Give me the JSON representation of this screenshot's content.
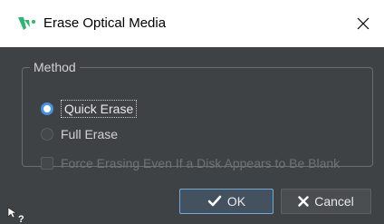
{
  "window": {
    "title": "Erase Optical Media",
    "app_icon": "wavelab-logo-icon",
    "close_icon": "close-icon"
  },
  "method": {
    "legend": "Method",
    "options": [
      {
        "label": "Quick Erase",
        "selected": true,
        "enabled": true
      },
      {
        "label": "Full Erase",
        "selected": false,
        "enabled": true
      }
    ],
    "force_checkbox": {
      "label": "Force Erasing Even If a Disk Appears to Be Blank",
      "checked": false,
      "enabled": false
    }
  },
  "buttons": {
    "ok_label": "OK",
    "ok_icon": "checkmark-icon",
    "cancel_label": "Cancel",
    "cancel_icon": "x-icon"
  },
  "help": {
    "icon": "whats-this-help-icon"
  },
  "colors": {
    "dialog_bg": "#3f4245",
    "titlebar_bg": "#ffffff",
    "accent": "#4a90e2",
    "logo_green": "#2bb673"
  }
}
